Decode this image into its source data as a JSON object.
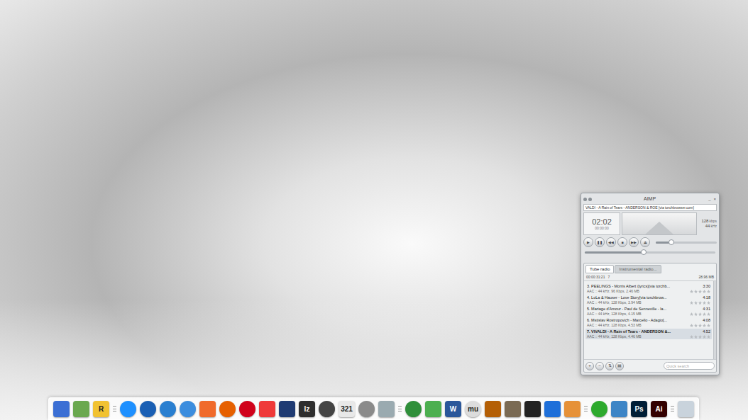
{
  "player": {
    "title": "AIMP",
    "window_buttons": [
      "_",
      "×"
    ],
    "track": "VALDI - A Rain of Tears - ANDERSON & ROE [via torchbrowser.com]",
    "time": "02:02",
    "time_sub": "00:00:00",
    "bitrate": "128",
    "bitrate_unit": "kbps",
    "samplerate": "44",
    "samplerate_unit": "kHz",
    "controls": [
      "▶",
      "❚❚",
      "◀◀",
      "■",
      "▶▶",
      "⏏"
    ],
    "volume": {
      "level": 0.25
    },
    "position": {
      "level": 0.45
    }
  },
  "playlist": {
    "tabs": [
      {
        "label": "Tube radio",
        "selected": true
      },
      {
        "label": "Instrumental radio...",
        "selected": false
      }
    ],
    "duration": "00:00:31:21",
    "count": "7",
    "size": "28.96 MB",
    "items": [
      {
        "title": "3. PEELINGS - Morris Albert (lyrics)[via torchb...",
        "length": "3:30",
        "info": "AAC :: 44 kHz, 96 Kbps, 2.46 MB",
        "stars": 0,
        "playing": false
      },
      {
        "title": "4. LoLa & Hauser - Love Story[via torchbrow...",
        "length": "4:18",
        "info": "AAC :: 44 kHz, 128 Kbps, 3.94 MB",
        "stars": 0,
        "playing": false
      },
      {
        "title": "5. Mariage d'Amour - Paul de Senneville - la...",
        "length": "4:31",
        "info": "AAC :: 44 kHz, 128 Kbps, 4.15 MB",
        "stars": 0,
        "playing": false
      },
      {
        "title": "6. Mstislav Rostropovich - Marcello - Adagio[...",
        "length": "4:08",
        "info": "AAC :: 44 kHz, 128 Kbps, 4.53 MB",
        "stars": 0,
        "playing": false
      },
      {
        "title": "7. VIVALDI - A Rain of Tears - ANDERSON &...",
        "length": "4:52",
        "info": "AAC :: 44 kHz, 128 Kbps, 4.46 MB",
        "stars": 0,
        "playing": true
      }
    ],
    "buttons": [
      "+",
      "−",
      "⇅",
      "▤"
    ],
    "search": {
      "placeholder": "Quick search"
    }
  },
  "dock": [
    {
      "kind": "tile",
      "color": "#3b6fd4",
      "label": ""
    },
    {
      "kind": "tile",
      "color": "#6aa84f",
      "label": ""
    },
    {
      "kind": "tile",
      "color": "#f1c232",
      "label": "R"
    },
    {
      "kind": "separator",
      "color": "#9a9a9a",
      "label": ""
    },
    {
      "kind": "round",
      "color": "#1e90ff",
      "label": ""
    },
    {
      "kind": "round",
      "color": "#1a5fb4",
      "label": ""
    },
    {
      "kind": "round",
      "color": "#2a7fd0",
      "label": ""
    },
    {
      "kind": "round",
      "color": "#3c8dde",
      "label": ""
    },
    {
      "kind": "tile",
      "color": "#f06a2b",
      "label": ""
    },
    {
      "kind": "round",
      "color": "#e66000",
      "label": ""
    },
    {
      "kind": "round",
      "color": "#d0021b",
      "label": ""
    },
    {
      "kind": "tile",
      "color": "#ef3939",
      "label": ""
    },
    {
      "kind": "tile",
      "color": "#1f3b73",
      "label": ""
    },
    {
      "kind": "tile",
      "color": "#2e2e2e",
      "label": "lz"
    },
    {
      "kind": "round",
      "color": "#444444",
      "label": ""
    },
    {
      "kind": "tile",
      "color": "#e8e8e8",
      "label": "321"
    },
    {
      "kind": "round",
      "color": "#8a8a8a",
      "label": ""
    },
    {
      "kind": "tile",
      "color": "#9aaab0",
      "label": ""
    },
    {
      "kind": "separator",
      "color": "#9a9a9a",
      "label": ""
    },
    {
      "kind": "round",
      "color": "#2f8f3a",
      "label": ""
    },
    {
      "kind": "tile",
      "color": "#4caf50",
      "label": ""
    },
    {
      "kind": "tile",
      "color": "#2b579a",
      "label": "W"
    },
    {
      "kind": "round",
      "color": "#dcdcdc",
      "label": "mu"
    },
    {
      "kind": "tile",
      "color": "#b45f06",
      "label": ""
    },
    {
      "kind": "tile",
      "color": "#7a6a53",
      "label": ""
    },
    {
      "kind": "tile",
      "color": "#222222",
      "label": ""
    },
    {
      "kind": "tile",
      "color": "#1e6fd9",
      "label": ""
    },
    {
      "kind": "tile",
      "color": "#e69138",
      "label": ""
    },
    {
      "kind": "separator",
      "color": "#9a9a9a",
      "label": ""
    },
    {
      "kind": "round",
      "color": "#2eaa2e",
      "label": ""
    },
    {
      "kind": "tile",
      "color": "#3d85c6",
      "label": ""
    },
    {
      "kind": "tile",
      "color": "#001e36",
      "label": "Ps"
    },
    {
      "kind": "tile",
      "color": "#330000",
      "label": "Ai"
    },
    {
      "kind": "separator",
      "color": "#9a9a9a",
      "label": ""
    },
    {
      "kind": "tile",
      "color": "#c9d3dc",
      "label": ""
    }
  ]
}
